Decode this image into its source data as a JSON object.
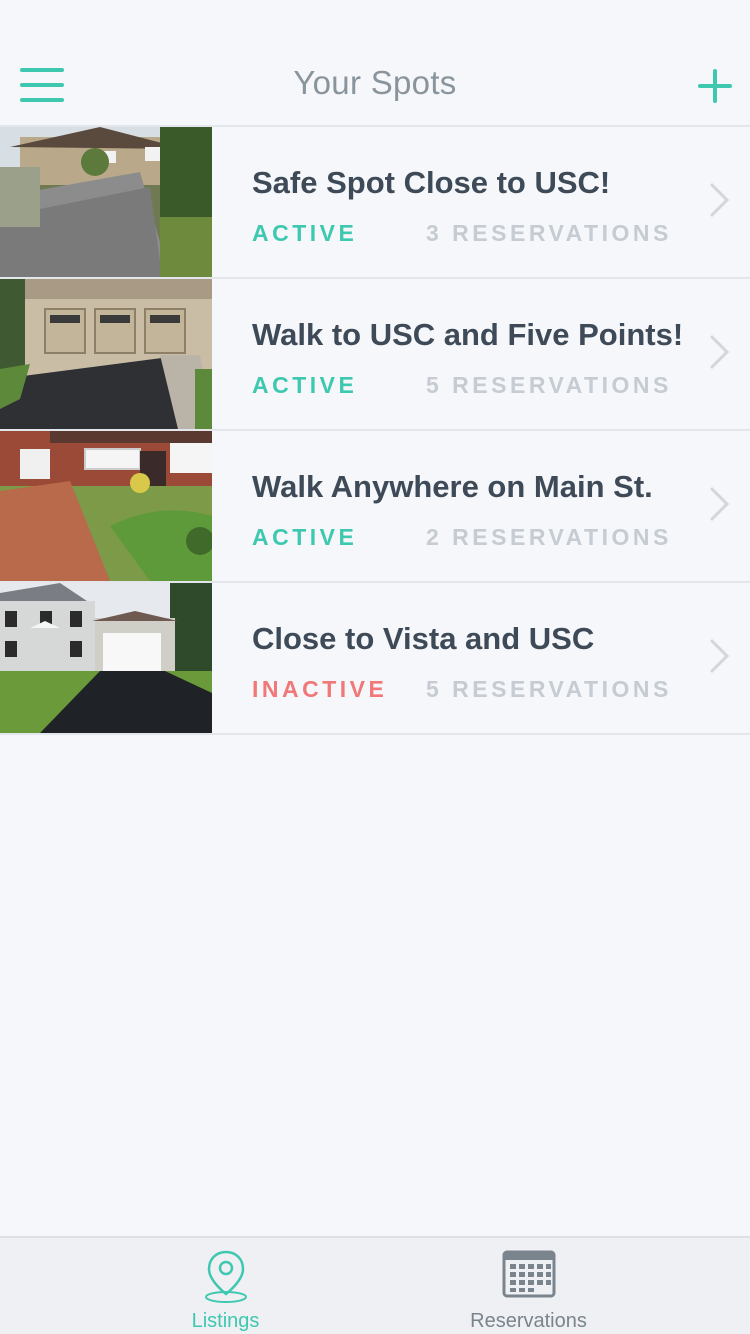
{
  "header": {
    "title": "Your Spots",
    "menu_icon": "hamburger-menu-icon",
    "add_icon": "plus-icon"
  },
  "colors": {
    "accent": "#3fc8b0",
    "inactive": "#f07878",
    "title_text": "#3e4a57",
    "muted": "#c6ccd2",
    "background": "#f5f7fa"
  },
  "listings": [
    {
      "title": "Safe Spot Close to USC!",
      "status": "ACTIVE",
      "reservations": "3 RESERVATIONS"
    },
    {
      "title": "Walk to USC and Five Points!",
      "status": "ACTIVE",
      "reservations": "5 RESERVATIONS"
    },
    {
      "title": "Walk Anywhere on Main St.",
      "status": "ACTIVE",
      "reservations": "2 RESERVATIONS"
    },
    {
      "title": "Close to Vista and USC",
      "status": "INACTIVE",
      "reservations": "5 RESERVATIONS"
    }
  ],
  "tabbar": {
    "listings_label": "Listings",
    "listings_icon": "map-pin-icon",
    "reservations_label": "Reservations",
    "reservations_icon": "calendar-grid-icon"
  }
}
